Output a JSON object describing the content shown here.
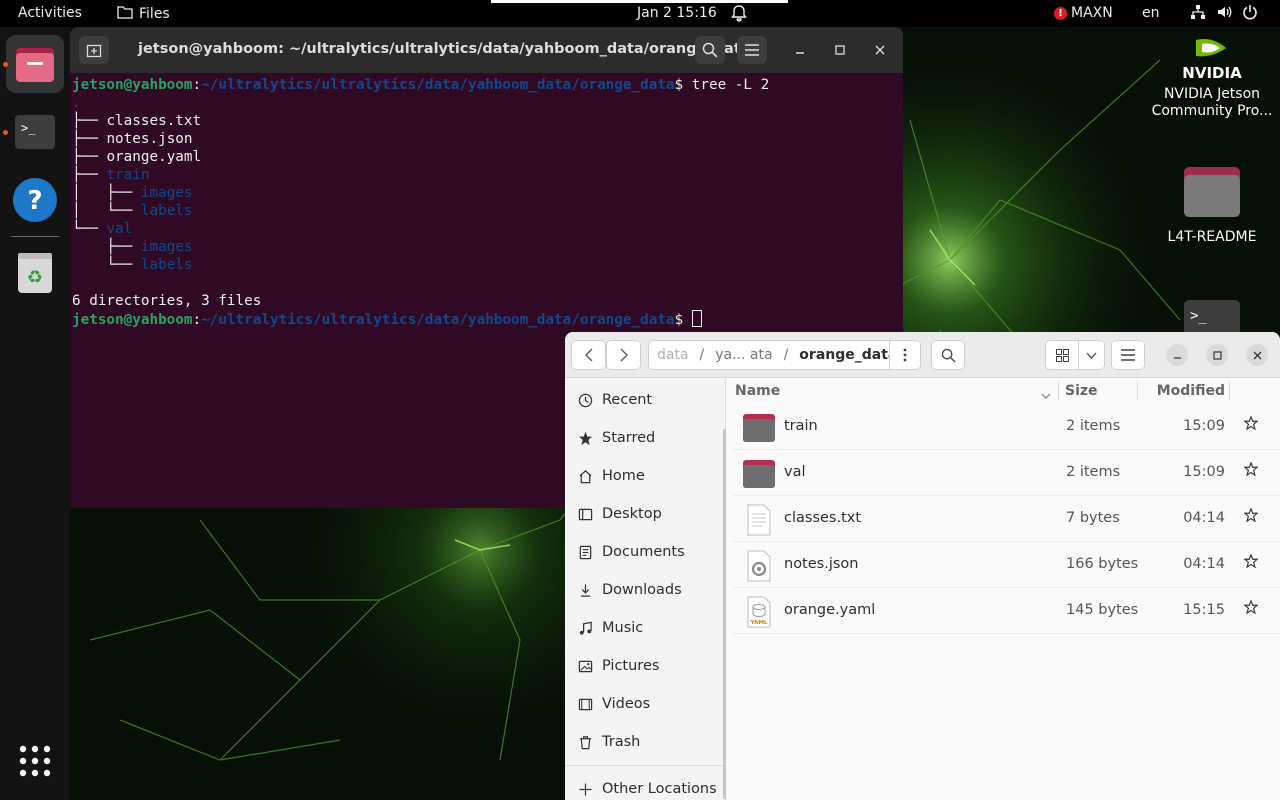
{
  "topbar": {
    "activities": "Activities",
    "app_name": "Files",
    "clock": "Jan 2  15:16",
    "power_mode": "MAXN",
    "language": "en"
  },
  "dock": {
    "items": [
      "files-app",
      "terminal-app",
      "help-app",
      "trash-app",
      "show-apps"
    ]
  },
  "terminal": {
    "title": "jetson@yahboom: ~/ultralytics/ultralytics/data/yahboom_data/orange_data",
    "prompt_user": "jetson@yahboom",
    "prompt_path": "~/ultralytics/ultralytics/data/yahboom_data/orange_data",
    "command": "tree -L 2",
    "tree_root": ".",
    "files": [
      "classes.txt",
      "notes.json",
      "orange.yaml"
    ],
    "dir_train": "train",
    "dir_val": "val",
    "sub_images": "images",
    "sub_labels": "labels",
    "summary": "6 directories, 3 files"
  },
  "desktop": {
    "nvidia_label": "NVIDIA Jetson",
    "nvidia_sublabel": "Community Pro...",
    "readme_label": "L4T-README",
    "nvidia_logo_text": "NVIDIA"
  },
  "files": {
    "breadcrumb": {
      "first": "data",
      "second": "ya... ata",
      "current": "orange_data",
      "sep1": "/",
      "sep2": "/"
    },
    "sidebar": {
      "recent": "Recent",
      "starred": "Starred",
      "home": "Home",
      "desktop": "Desktop",
      "documents": "Documents",
      "downloads": "Downloads",
      "music": "Music",
      "pictures": "Pictures",
      "videos": "Videos",
      "trash": "Trash",
      "other": "Other Locations"
    },
    "columns": {
      "name": "Name",
      "size": "Size",
      "modified": "Modified"
    },
    "rows": [
      {
        "name": "train",
        "size": "2 items",
        "modified": "15:09",
        "type": "folder"
      },
      {
        "name": "val",
        "size": "2 items",
        "modified": "15:09",
        "type": "folder"
      },
      {
        "name": "classes.txt",
        "size": "7 bytes",
        "modified": "04:14",
        "type": "text"
      },
      {
        "name": "notes.json",
        "size": "166 bytes",
        "modified": "04:14",
        "type": "json"
      },
      {
        "name": "orange.yaml",
        "size": "145 bytes",
        "modified": "15:15",
        "type": "yaml"
      }
    ]
  },
  "colors": {
    "terminal_bg": "#300a24",
    "prompt_user": "#26a269",
    "prompt_path": "#12488b",
    "folder_top": "#b5304f",
    "accent": "#e95420"
  }
}
